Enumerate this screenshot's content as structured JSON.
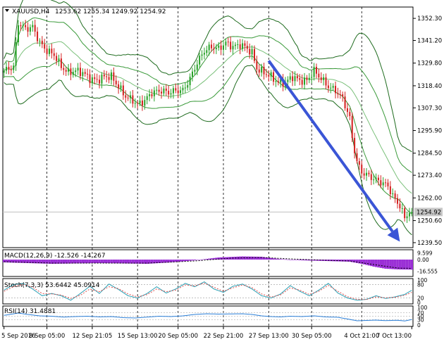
{
  "window": {
    "title": "XAUUSD,H4",
    "ohlc": "1253.62 1255.34 1249.92 1254.92",
    "menu_icon": "triangle-down-icon"
  },
  "chart_data": {
    "type": "candlestick",
    "symbol": "XAUUSD",
    "timeframe": "H4",
    "ylim": [
      1237.0,
      1358.0
    ],
    "y_ticks": [
      "1352.30",
      "1341.20",
      "1329.80",
      "1318.40",
      "1307.30",
      "1295.90",
      "1284.50",
      "1273.40",
      "1262.00",
      "1250.60",
      "1239.50"
    ],
    "current_price": "1254.92",
    "x_labels": [
      "5 Sep 2016",
      "8 Sep 05:00",
      "12 Sep 21:05",
      "15 Sep 13:00",
      "20 Sep 05:00",
      "22 Sep 21:00",
      "27 Sep 13:00",
      "30 Sep 05:00",
      "4 Oct 21:00",
      "7 Oct 13:00"
    ],
    "vlines_at_index": [
      18,
      37,
      56,
      73,
      92,
      111,
      129,
      150
    ],
    "bull_color": "#27a127",
    "bear_color": "#d42020",
    "close_path": [
      [
        0,
        1326
      ],
      [
        4,
        1328
      ],
      [
        6,
        1350
      ],
      [
        9,
        1347
      ],
      [
        12,
        1348
      ],
      [
        15,
        1340
      ],
      [
        18,
        1336
      ],
      [
        21,
        1334
      ],
      [
        24,
        1328
      ],
      [
        27,
        1325
      ],
      [
        30,
        1326
      ],
      [
        33,
        1325
      ],
      [
        36,
        1322
      ],
      [
        39,
        1321
      ],
      [
        42,
        1323
      ],
      [
        45,
        1323
      ],
      [
        48,
        1318
      ],
      [
        51,
        1313
      ],
      [
        54,
        1311
      ],
      [
        56,
        1309
      ],
      [
        59,
        1311
      ],
      [
        62,
        1315
      ],
      [
        66,
        1316
      ],
      [
        69,
        1315
      ],
      [
        72,
        1316
      ],
      [
        75,
        1316
      ],
      [
        78,
        1322
      ],
      [
        81,
        1330
      ],
      [
        84,
        1336
      ],
      [
        87,
        1338
      ],
      [
        90,
        1337
      ],
      [
        93,
        1340
      ],
      [
        96,
        1338
      ],
      [
        99,
        1339
      ],
      [
        101,
        1338
      ],
      [
        104,
        1335
      ],
      [
        106,
        1327
      ],
      [
        109,
        1325
      ],
      [
        112,
        1323
      ],
      [
        115,
        1320
      ],
      [
        118,
        1320
      ],
      [
        121,
        1323
      ],
      [
        124,
        1321
      ],
      [
        127,
        1321
      ],
      [
        130,
        1326
      ],
      [
        133,
        1322
      ],
      [
        136,
        1318
      ],
      [
        139,
        1316
      ],
      [
        142,
        1312
      ],
      [
        145,
        1302
      ],
      [
        146,
        1292
      ],
      [
        148,
        1280
      ],
      [
        150,
        1275
      ],
      [
        153,
        1273
      ],
      [
        156,
        1271
      ],
      [
        158,
        1270
      ],
      [
        161,
        1268
      ],
      [
        163,
        1263
      ],
      [
        166,
        1258
      ],
      [
        168,
        1252
      ],
      [
        170,
        1255
      ],
      [
        171,
        1254.92
      ]
    ],
    "arrow": {
      "from": [
        111,
        1331
      ],
      "to": [
        166,
        1240
      ],
      "color": "#3a55d6"
    },
    "indicators": {
      "macd": {
        "label": "MACD(12,26,9) -12.526 -14.267",
        "y_ticks": [
          "9.599",
          "0.00",
          "-16.555"
        ],
        "ylim": [
          -22,
          12
        ],
        "hist": [
          [
            0,
            -4
          ],
          [
            10,
            -5
          ],
          [
            20,
            -6
          ],
          [
            30,
            -5.5
          ],
          [
            40,
            -5
          ],
          [
            50,
            -5.5
          ],
          [
            60,
            -6
          ],
          [
            70,
            -4
          ],
          [
            80,
            -1
          ],
          [
            90,
            3
          ],
          [
            100,
            4.5
          ],
          [
            108,
            4
          ],
          [
            115,
            1
          ],
          [
            125,
            -1
          ],
          [
            135,
            -2
          ],
          [
            145,
            -3
          ],
          [
            150,
            -6
          ],
          [
            155,
            -10
          ],
          [
            160,
            -13
          ],
          [
            165,
            -14
          ],
          [
            171,
            -14.3
          ]
        ],
        "hist_color": "#9b30d6",
        "signal": [
          [
            0,
            -3
          ],
          [
            20,
            -5
          ],
          [
            40,
            -5
          ],
          [
            60,
            -5
          ],
          [
            80,
            -2
          ],
          [
            95,
            2
          ],
          [
            108,
            3
          ],
          [
            120,
            1
          ],
          [
            135,
            -1
          ],
          [
            145,
            -2
          ],
          [
            155,
            -7
          ],
          [
            165,
            -12
          ],
          [
            171,
            -12.5
          ]
        ]
      },
      "stoch": {
        "label": "Stoch(7,3,3) 53.6442 45.0914",
        "y_ticks": [
          "100",
          "80",
          "20",
          "0"
        ],
        "ylim": [
          0,
          100
        ],
        "main": [
          [
            0,
            55
          ],
          [
            4,
            80
          ],
          [
            8,
            85
          ],
          [
            12,
            60
          ],
          [
            16,
            30
          ],
          [
            20,
            40
          ],
          [
            24,
            30
          ],
          [
            28,
            10
          ],
          [
            32,
            40
          ],
          [
            36,
            72
          ],
          [
            40,
            40
          ],
          [
            44,
            82
          ],
          [
            48,
            58
          ],
          [
            52,
            30
          ],
          [
            56,
            20
          ],
          [
            60,
            40
          ],
          [
            64,
            70
          ],
          [
            68,
            42
          ],
          [
            72,
            60
          ],
          [
            76,
            85
          ],
          [
            80,
            70
          ],
          [
            84,
            92
          ],
          [
            88,
            60
          ],
          [
            92,
            45
          ],
          [
            96,
            72
          ],
          [
            100,
            82
          ],
          [
            104,
            60
          ],
          [
            108,
            30
          ],
          [
            112,
            20
          ],
          [
            116,
            38
          ],
          [
            120,
            75
          ],
          [
            124,
            50
          ],
          [
            128,
            30
          ],
          [
            132,
            55
          ],
          [
            136,
            85
          ],
          [
            140,
            42
          ],
          [
            144,
            20
          ],
          [
            148,
            10
          ],
          [
            152,
            14
          ],
          [
            156,
            30
          ],
          [
            160,
            18
          ],
          [
            164,
            25
          ],
          [
            168,
            36
          ],
          [
            171,
            54
          ]
        ],
        "signal": [
          [
            0,
            50
          ],
          [
            4,
            70
          ],
          [
            8,
            80
          ],
          [
            12,
            68
          ],
          [
            16,
            40
          ],
          [
            20,
            38
          ],
          [
            24,
            33
          ],
          [
            28,
            18
          ],
          [
            32,
            32
          ],
          [
            36,
            60
          ],
          [
            40,
            48
          ],
          [
            44,
            70
          ],
          [
            48,
            62
          ],
          [
            52,
            38
          ],
          [
            56,
            25
          ],
          [
            60,
            35
          ],
          [
            64,
            60
          ],
          [
            68,
            48
          ],
          [
            72,
            55
          ],
          [
            76,
            78
          ],
          [
            80,
            74
          ],
          [
            84,
            86
          ],
          [
            88,
            68
          ],
          [
            92,
            50
          ],
          [
            96,
            65
          ],
          [
            100,
            78
          ],
          [
            104,
            66
          ],
          [
            108,
            38
          ],
          [
            112,
            24
          ],
          [
            116,
            34
          ],
          [
            120,
            65
          ],
          [
            124,
            55
          ],
          [
            128,
            36
          ],
          [
            132,
            50
          ],
          [
            136,
            76
          ],
          [
            140,
            50
          ],
          [
            144,
            26
          ],
          [
            148,
            14
          ],
          [
            152,
            13
          ],
          [
            156,
            25
          ],
          [
            160,
            21
          ],
          [
            164,
            23
          ],
          [
            168,
            32
          ],
          [
            171,
            45
          ]
        ],
        "main_color": "#2aa0b5",
        "signal_color": "#e05050"
      },
      "rsi": {
        "label": "RSI(14) 31.4881",
        "y_ticks": [
          "100",
          "70",
          "50",
          "30",
          "0"
        ],
        "ylim": [
          0,
          100
        ],
        "values": [
          [
            0,
            55
          ],
          [
            6,
            68
          ],
          [
            10,
            60
          ],
          [
            15,
            52
          ],
          [
            20,
            50
          ],
          [
            25,
            45
          ],
          [
            30,
            48
          ],
          [
            35,
            50
          ],
          [
            40,
            46
          ],
          [
            45,
            48
          ],
          [
            50,
            42
          ],
          [
            55,
            40
          ],
          [
            60,
            45
          ],
          [
            65,
            50
          ],
          [
            70,
            48
          ],
          [
            75,
            52
          ],
          [
            80,
            60
          ],
          [
            85,
            64
          ],
          [
            90,
            62
          ],
          [
            95,
            63
          ],
          [
            100,
            64
          ],
          [
            104,
            60
          ],
          [
            108,
            52
          ],
          [
            112,
            48
          ],
          [
            116,
            46
          ],
          [
            120,
            50
          ],
          [
            125,
            48
          ],
          [
            130,
            52
          ],
          [
            135,
            46
          ],
          [
            140,
            44
          ],
          [
            145,
            32
          ],
          [
            148,
            24
          ],
          [
            152,
            26
          ],
          [
            156,
            28
          ],
          [
            160,
            25
          ],
          [
            165,
            27
          ],
          [
            168,
            23
          ],
          [
            171,
            31
          ]
        ],
        "color": "#2b7fd8"
      }
    }
  }
}
